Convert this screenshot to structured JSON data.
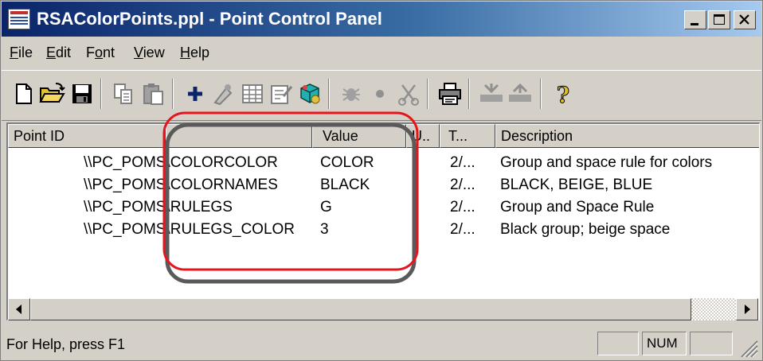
{
  "window": {
    "title": "RSAColorPoints.ppl - Point Control Panel",
    "caption_buttons": [
      "minimize",
      "maximize",
      "close"
    ]
  },
  "menu": [
    {
      "label": "File",
      "underline": "F"
    },
    {
      "label": "Edit",
      "underline": "E"
    },
    {
      "label": "Font",
      "underline": "o"
    },
    {
      "label": "View",
      "underline": "V"
    },
    {
      "label": "Help",
      "underline": "H"
    }
  ],
  "toolbar": {
    "buttons": [
      {
        "icon": "new-document-icon",
        "enabled": true
      },
      {
        "icon": "open-folder-icon",
        "enabled": true
      },
      {
        "icon": "save-disk-icon",
        "enabled": true
      },
      {
        "icon": "copy-icon",
        "enabled": false
      },
      {
        "icon": "paste-icon",
        "enabled": false
      },
      {
        "icon": "add-point-icon",
        "enabled": true
      },
      {
        "icon": "edit-point-icon",
        "enabled": false
      },
      {
        "icon": "grid-icon",
        "enabled": false
      },
      {
        "icon": "properties-icon",
        "enabled": false
      },
      {
        "icon": "color-icon",
        "enabled": true
      },
      {
        "icon": "bug-icon",
        "enabled": false
      },
      {
        "icon": "dot-icon",
        "enabled": false
      },
      {
        "icon": "cut-icon",
        "enabled": false
      },
      {
        "icon": "print-icon",
        "enabled": true
      },
      {
        "icon": "import-icon",
        "enabled": false
      },
      {
        "icon": "export-icon",
        "enabled": false
      },
      {
        "icon": "help-icon",
        "enabled": true
      }
    ]
  },
  "list": {
    "columns": [
      "Point ID",
      "",
      "Value",
      "U..",
      "T...",
      "Description"
    ],
    "rows": [
      {
        "point_id": "\\\\PC_POMS\\COLORCOLOR",
        "value": "COLOR",
        "units": "",
        "time": "2/...",
        "description": "Group and space rule for colors"
      },
      {
        "point_id": "\\\\PC_POMS\\COLORNAMES",
        "value": "BLACK",
        "units": "",
        "time": "2/...",
        "description": "BLACK, BEIGE, BLUE"
      },
      {
        "point_id": "\\\\PC_POMS\\RULEGS",
        "value": "G",
        "units": "",
        "time": "2/...",
        "description": "Group and Space Rule"
      },
      {
        "point_id": "\\\\PC_POMS\\RULEGS_COLOR",
        "value": "3",
        "units": "",
        "time": "2/...",
        "description": "Black group; beige space"
      }
    ]
  },
  "status": {
    "text": "For Help, press F1",
    "panes": [
      "",
      "NUM",
      ""
    ]
  },
  "annotation": {
    "outer_color": "#e8141c",
    "inner_color": "#5a5a5a"
  }
}
